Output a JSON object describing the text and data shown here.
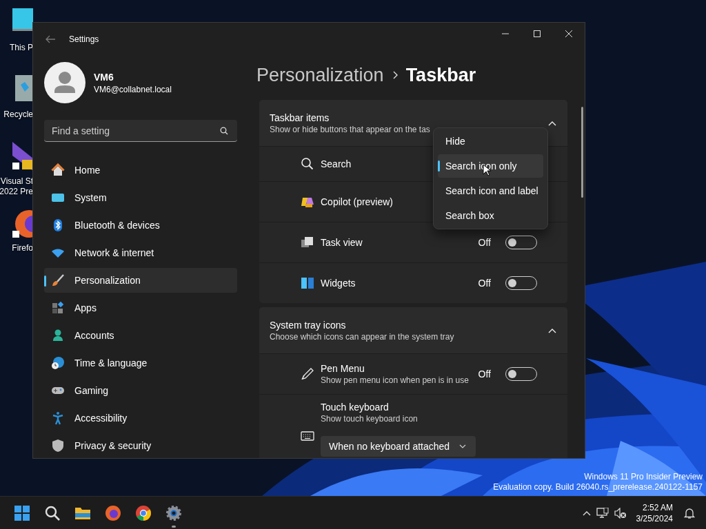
{
  "desktop": {
    "icons": [
      {
        "lines": [
          "This P"
        ]
      },
      {
        "lines": [
          "Recycle"
        ]
      },
      {
        "lines": [
          "Visual St",
          "2022 Pre"
        ]
      },
      {
        "lines": [
          "Firefo"
        ]
      }
    ],
    "build_info": [
      "Windows 11 Pro Insider Preview",
      "Evaluation copy. Build 26040.rs_prerelease.240122-1157"
    ]
  },
  "window": {
    "title": "Settings"
  },
  "account": {
    "name": "VM6",
    "email": "VM6@collabnet.local"
  },
  "search": {
    "placeholder": "Find a setting"
  },
  "nav": [
    {
      "label": "Home",
      "selected": false
    },
    {
      "label": "System",
      "selected": false
    },
    {
      "label": "Bluetooth & devices",
      "selected": false
    },
    {
      "label": "Network & internet",
      "selected": false
    },
    {
      "label": "Personalization",
      "selected": true
    },
    {
      "label": "Apps",
      "selected": false
    },
    {
      "label": "Accounts",
      "selected": false
    },
    {
      "label": "Time & language",
      "selected": false
    },
    {
      "label": "Gaming",
      "selected": false
    },
    {
      "label": "Accessibility",
      "selected": false
    },
    {
      "label": "Privacy & security",
      "selected": false
    }
  ],
  "breadcrumb": {
    "parent": "Personalization",
    "current": "Taskbar"
  },
  "sections": [
    {
      "title": "Taskbar items",
      "subtitle": "Show or hide buttons that appear on the tas",
      "expanded": true,
      "rows": [
        {
          "kind": "plain",
          "label": "Search"
        },
        {
          "kind": "plain",
          "label": "Copilot (preview)"
        },
        {
          "kind": "toggle",
          "label": "Task view",
          "state_label": "Off",
          "on": false
        },
        {
          "kind": "toggle",
          "label": "Widgets",
          "state_label": "Off",
          "on": false
        }
      ]
    },
    {
      "title": "System tray icons",
      "subtitle": "Choose which icons can appear in the system tray",
      "expanded": true,
      "rows": [
        {
          "kind": "toggle",
          "label": "Pen Menu",
          "description": "Show pen menu icon when pen is in use",
          "state_label": "Off",
          "on": false
        },
        {
          "kind": "dropdown",
          "label": "Touch keyboard",
          "description": "Show touch keyboard icon",
          "value": "When no keyboard attached"
        }
      ]
    }
  ],
  "popup_menu": {
    "items": [
      {
        "label": "Hide",
        "selected": false
      },
      {
        "label": "Search icon only",
        "selected": true
      },
      {
        "label": "Search icon and label",
        "selected": false
      },
      {
        "label": "Search box",
        "selected": false
      }
    ]
  },
  "taskbar": {
    "apps": [
      {
        "running": false
      },
      {
        "running": false
      },
      {
        "running": false
      },
      {
        "running": false
      },
      {
        "running": false
      },
      {
        "running": true
      }
    ],
    "clock": {
      "time": "2:52 AM",
      "date": "3/25/2024"
    }
  }
}
